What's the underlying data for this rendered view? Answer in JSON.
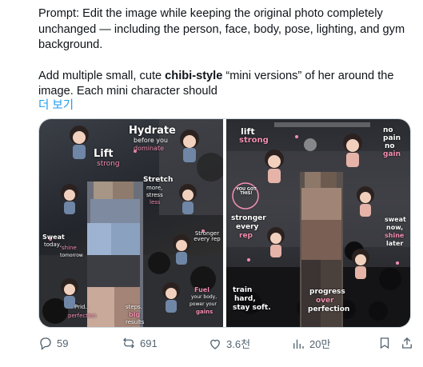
{
  "post": {
    "line1": "Prompt: Edit the image while keeping the original photo completely",
    "line2": "unchanged — including the person, face, body, pose, lighting, and gym",
    "line3": "background.",
    "para2_before": "Add multiple small, cute ",
    "para2_bold": "chibi-style",
    "para2_after": " “mini versions” of her around the",
    "line5": "image. Each mini character should",
    "show_more": "더 보기"
  },
  "left_panel": {
    "texts": {
      "hydrate": "Hydrate",
      "before_you": "before you",
      "dominate": "dominate",
      "lift": "Lift",
      "strong": "strong",
      "stretch": "Stretch",
      "more": "more,",
      "stress": "stress",
      "less": "less",
      "sweat": "Sweat",
      "today": "today,",
      "shine": "shine",
      "tomorrow": "tomorrow",
      "stronger_every_rep": "Stronger every rep",
      "pride": "Prid...",
      "perfection": "perfection",
      "steps": "steps.",
      "big": "big",
      "results": "results",
      "fuel": "Fuel",
      "your_body": "your body,",
      "power_your": "power your",
      "gains": "gains"
    }
  },
  "right_panel": {
    "texts": {
      "lift": "lift",
      "strong": "strong",
      "no": "no",
      "pain": "pain",
      "no2": "no",
      "gain": "gain",
      "you_got_this": "YOU GOT THIS!",
      "stronger": "stronger",
      "every": "every",
      "rep": "rep",
      "sweat": "sweat",
      "now": "now,",
      "shine": "shine",
      "later": "later",
      "train": "train",
      "hard": "hard,",
      "stay_soft": "stay soft.",
      "progress": "progress",
      "over": "over",
      "perfection": "perfection"
    }
  },
  "actions": {
    "replies": "59",
    "reposts": "691",
    "likes": "3.6천",
    "views": "20만"
  },
  "colors": {
    "accent": "#1d9bf0",
    "muted": "#536471",
    "pink": "#f48fb1"
  }
}
